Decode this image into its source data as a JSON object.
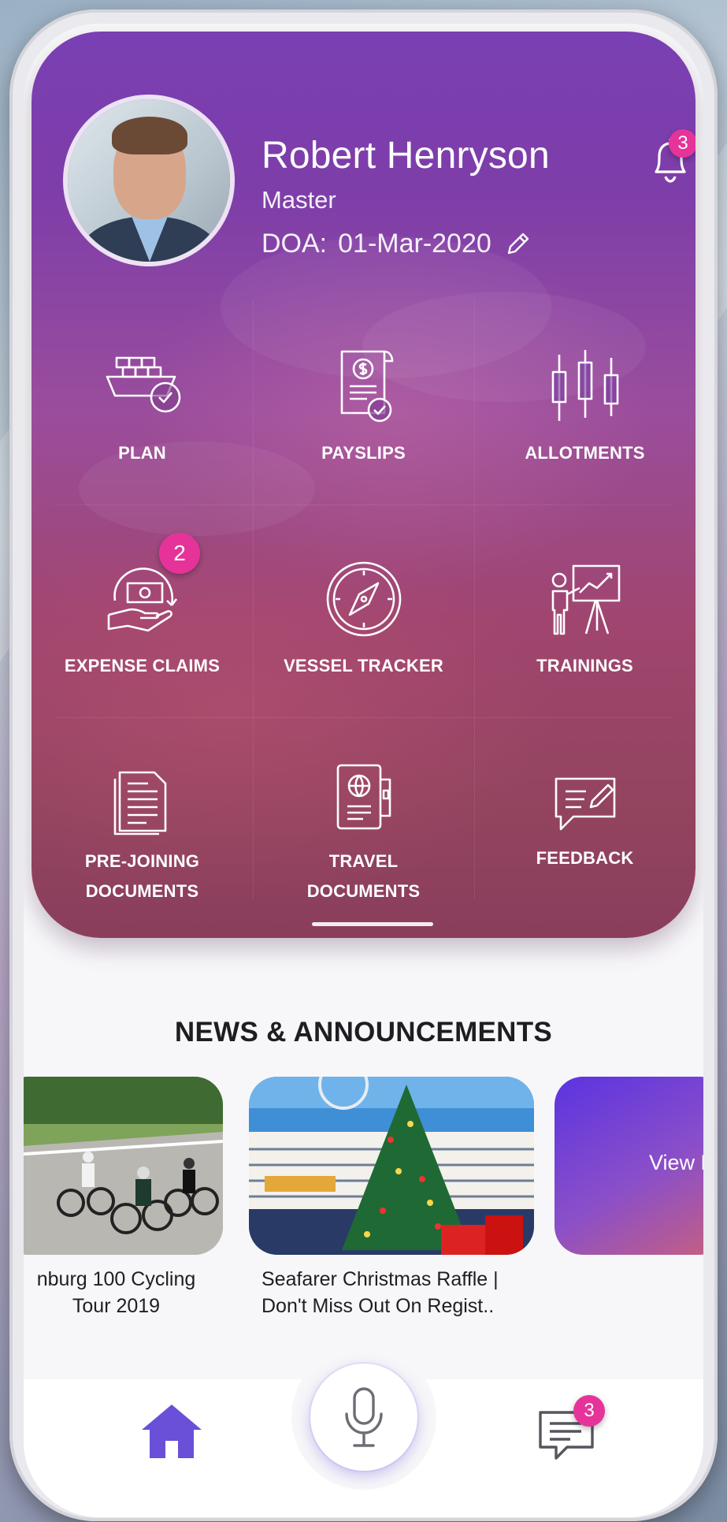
{
  "profile": {
    "name": "Robert Henryson",
    "role": "Master",
    "doa_label": "DOA:",
    "doa_value": "01-Mar-2020",
    "notification_count": "3"
  },
  "tiles": [
    {
      "label": "PLAN",
      "icon": "cargo-ship-check-icon"
    },
    {
      "label": "PAYSLIPS",
      "icon": "payslip-document-icon"
    },
    {
      "label": "ALLOTMENTS",
      "icon": "candlestick-chart-icon"
    },
    {
      "label": "EXPENSE CLAIMS",
      "icon": "money-hand-icon",
      "badge": "2"
    },
    {
      "label": "VESSEL TRACKER",
      "icon": "compass-icon"
    },
    {
      "label": "TRAININGS",
      "icon": "presentation-board-icon"
    },
    {
      "label_line1": "PRE-JOINING",
      "label_line2": "DOCUMENTS",
      "icon": "document-stack-icon"
    },
    {
      "label_line1": "TRAVEL",
      "label_line2": "DOCUMENTS",
      "icon": "passport-icon"
    },
    {
      "label": "FEEDBACK",
      "icon": "feedback-speech-icon"
    }
  ],
  "news": {
    "title": "NEWS & ANNOUNCEMENTS",
    "items": [
      {
        "line1": "nburg 100 Cycling",
        "line2": "Tour 2019"
      },
      {
        "line1": "Seafarer Christmas Raffle |",
        "line2": "Don't Miss Out On Regist.."
      },
      {
        "label": "View M"
      }
    ]
  },
  "nav": {
    "messages_badge": "3"
  },
  "colors": {
    "badge": "#e6339a",
    "accent": "#6a4fd8",
    "hero_top": "#7a3fb3",
    "hero_bottom": "#8a3e5c"
  }
}
